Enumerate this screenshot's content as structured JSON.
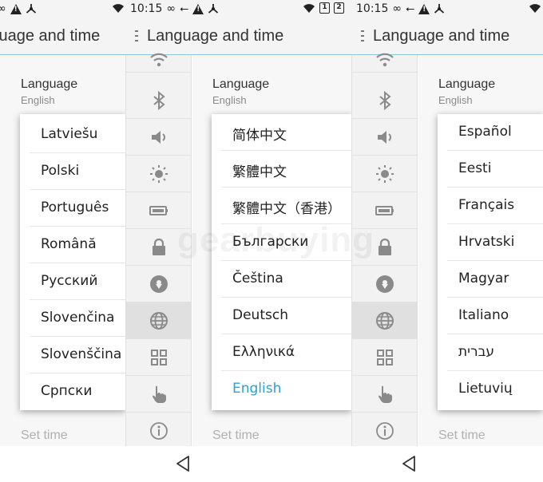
{
  "status": {
    "time": "10:15",
    "icons": [
      "usb-icon",
      "infinity-icon",
      "warning-icon",
      "network-icon",
      "wifi-icon",
      "sim1-icon",
      "sim2-icon"
    ],
    "sim1": "1",
    "sim2": "2"
  },
  "header": {
    "title": "Language and time"
  },
  "settings": {
    "language_label": "Language",
    "language_value": "English",
    "set_time_label": "Set time"
  },
  "panels": [
    {
      "options": [
        "Latviešu",
        "Polski",
        "Português",
        "Română",
        "Русский",
        "Slovenčina",
        "Slovenščina",
        "Српски"
      ],
      "selected": ""
    },
    {
      "options": [
        "简体中文",
        "繁體中文",
        "繁體中文（香港）",
        "Български",
        "Čeština",
        "Deutsch",
        "Ελληνικά",
        "English"
      ],
      "selected": "English"
    },
    {
      "options": [
        "Español",
        "Eesti",
        "Français",
        "Hrvatski",
        "Magyar",
        "Italiano",
        "עברית",
        "Lietuvių"
      ],
      "selected": ""
    }
  ],
  "sidebar": {
    "items": [
      {
        "icon": "wifi-icon"
      },
      {
        "icon": "bluetooth-icon"
      },
      {
        "icon": "volume-icon"
      },
      {
        "icon": "brightness-icon"
      },
      {
        "icon": "battery-icon"
      },
      {
        "icon": "lock-icon"
      },
      {
        "icon": "location-icon"
      },
      {
        "icon": "globe-icon",
        "active": true
      },
      {
        "icon": "apps-grid-icon"
      },
      {
        "icon": "gesture-hand-icon"
      },
      {
        "icon": "info-icon"
      }
    ]
  },
  "watermark": "gearbuying",
  "colors": {
    "accent": "#2aa3cf",
    "divider": "#8fc6d8",
    "rail_bg": "#f2f2f2",
    "rail_active": "#e0e0e0"
  }
}
